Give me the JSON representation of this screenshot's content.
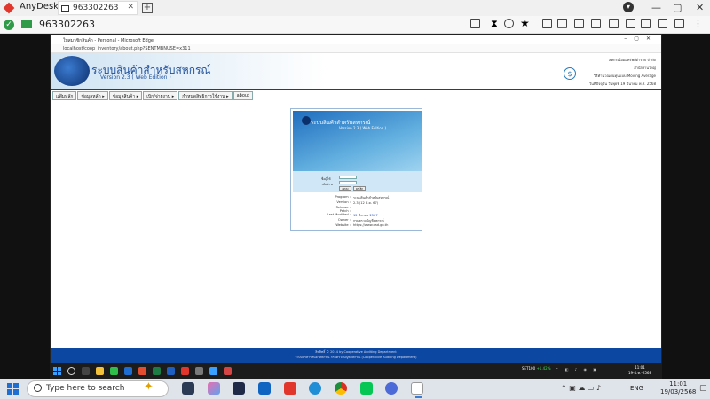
{
  "anydesk": {
    "app_name": "AnyDesk",
    "tab_id": "963302263",
    "session_id": "963302263"
  },
  "edge": {
    "title": "ใบสมาชิกสินค้า - Personal - Microsoft Edge",
    "url": "localhost/coop_inventory/about.php?SENTMBNUSE=x311"
  },
  "site": {
    "title": "ระบบสินค้าสำหรับสหกรณ์",
    "version": "Version 2.3 ( Web Edition )",
    "org": "สหกรณ์ออมทรัพย์ตำรวจ จำกัด",
    "branch": "สำนักงานใหญ่",
    "method": "วิธีคำนวณต้นทุนแบบ Moving Average",
    "date": "วันที่ปัจจุบัน วันพุธที่ 19 มีนาคม พ.ศ. 2568",
    "nav": [
      "แฟ้มหลัก",
      "ข้อมูลหลัก ▸",
      "ข้อมูลสินค้า ▸",
      "เบิก/จ่ายงาน ▸",
      "กำหนดสิทธิการใช้งาน ▸",
      "about"
    ],
    "footer_line1": "ลิขสิทธิ์ © 2014 by Cooperative Auditing Department",
    "footer_line2": "ระบบบริหารสินค้าสหกรณ์ กรมตรวจบัญชีสหกรณ์ (Cooperative Auditing Department)"
  },
  "login": {
    "banner_title": "ระบบสินค้าสำหรับสหกรณ์",
    "banner_version": "Version 2.3 ( Web Edition )",
    "user_label": "ชื่อผู้ใช้",
    "pass_label": "รหัสผ่าน",
    "ok_label": "ตกลง",
    "cancel_label": "ยกเลิก",
    "info": [
      {
        "k": "Program :",
        "v": "ระบบสินค้าสำหรับสหกรณ์"
      },
      {
        "k": "Version :",
        "v": "2.3 (12 มี.ค. 67)"
      },
      {
        "k": "Release :",
        "v": ""
      },
      {
        "k": "Patch :",
        "v": ""
      },
      {
        "k": "Last Modified :",
        "v": "12 มีนาคม 2567"
      },
      {
        "k": "Owner :",
        "v": "กรมตรวจบัญชีสหกรณ์"
      },
      {
        "k": "Website :",
        "v": "https://www.cad.go.th"
      }
    ]
  },
  "remote_taskbar": {
    "stock": "SET100",
    "stock_change": "+1.42%",
    "time": "11:01",
    "date": "19-มี.ค.-2568"
  },
  "local_taskbar": {
    "search_placeholder": "Type here to search",
    "lang": "ENG",
    "time": "11:01",
    "date": "19/03/2568"
  }
}
